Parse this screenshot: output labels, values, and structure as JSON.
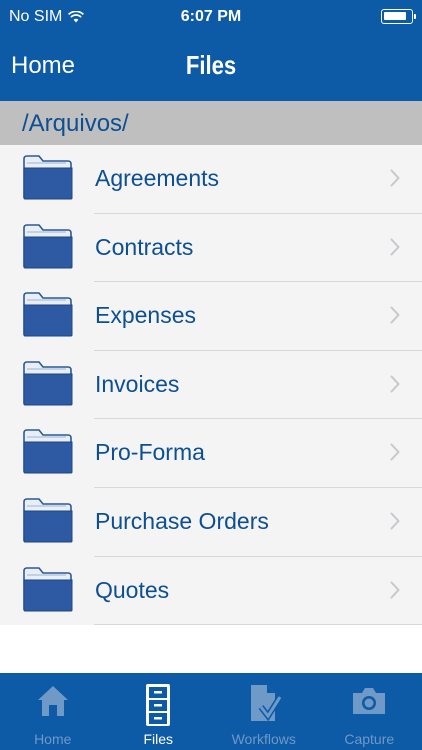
{
  "status_bar": {
    "carrier": "No SIM",
    "time": "6:07 PM",
    "battery_level": 0.85
  },
  "nav": {
    "back_label": "Home",
    "title": "Files"
  },
  "path": "/Arquivos/",
  "folders": [
    {
      "label": "Agreements",
      "icon": "folder-icon"
    },
    {
      "label": "Contracts",
      "icon": "folder-icon"
    },
    {
      "label": "Expenses",
      "icon": "folder-icon"
    },
    {
      "label": "Invoices",
      "icon": "folder-icon"
    },
    {
      "label": "Pro-Forma",
      "icon": "folder-icon"
    },
    {
      "label": "Purchase Orders",
      "icon": "folder-icon"
    },
    {
      "label": "Quotes",
      "icon": "folder-icon"
    }
  ],
  "tabs": [
    {
      "label": "Home",
      "icon": "home-icon",
      "active": false
    },
    {
      "label": "Files",
      "icon": "file-cabinet-icon",
      "active": true
    },
    {
      "label": "Workflows",
      "icon": "workflow-document-icon",
      "active": false
    },
    {
      "label": "Capture",
      "icon": "camera-icon",
      "active": false
    }
  ],
  "colors": {
    "brand_blue": "#0d5aa7",
    "path_bar_gray": "#bfbfbf",
    "label_blue": "#0d4f93",
    "inactive_tab": "#6f99c6"
  }
}
